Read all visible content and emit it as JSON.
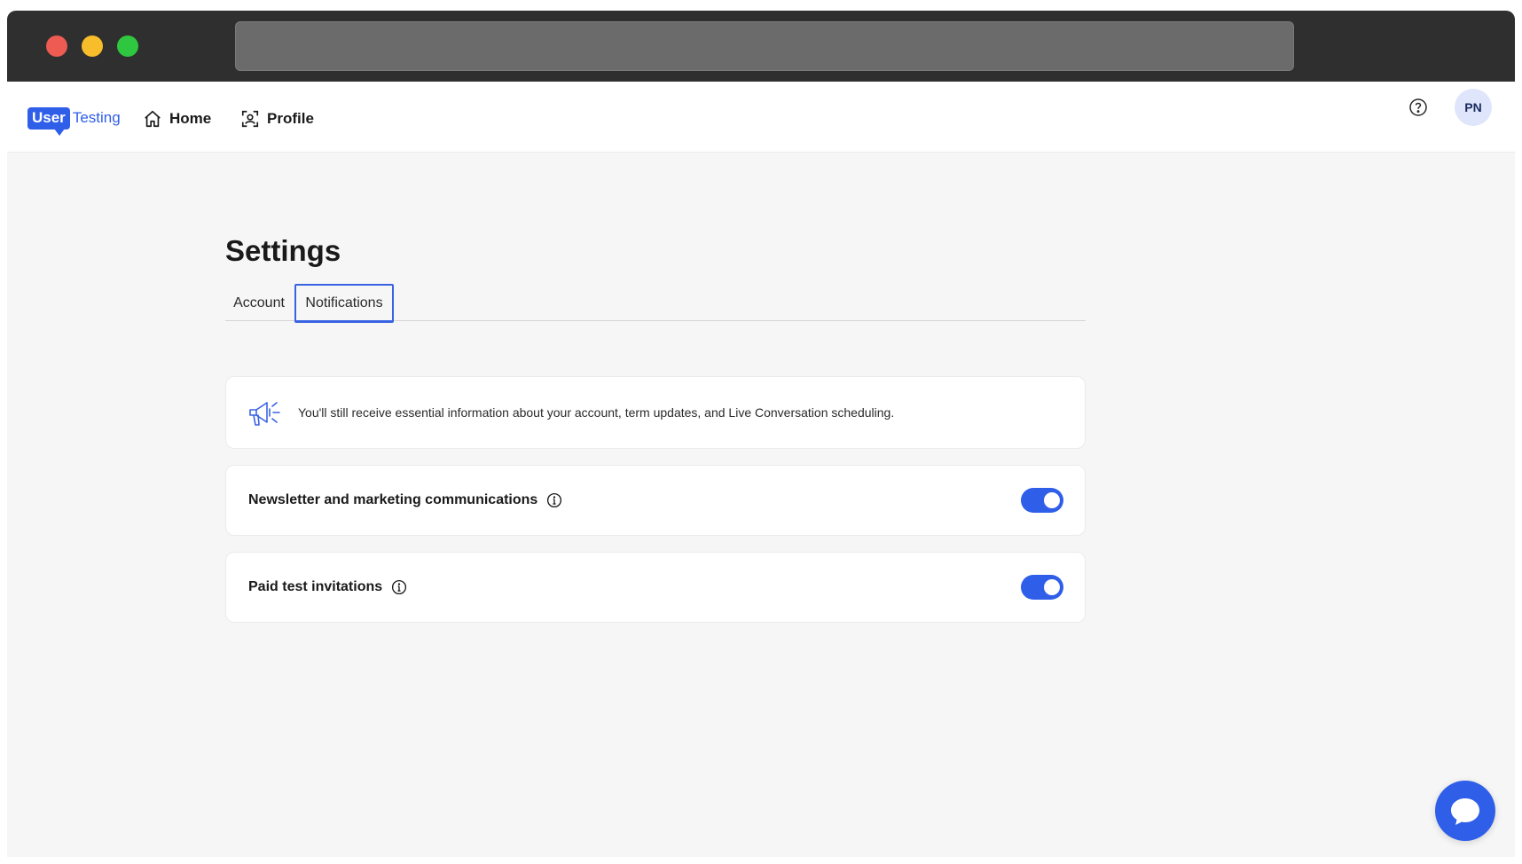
{
  "header": {
    "logo_user": "User",
    "logo_testing": "Testing",
    "nav": [
      {
        "label": "Home",
        "icon": "home-icon"
      },
      {
        "label": "Profile",
        "icon": "profile-icon"
      }
    ],
    "help_icon": "help-icon",
    "avatar_initials": "PN"
  },
  "main": {
    "title": "Settings",
    "tabs": [
      {
        "label": "Account",
        "active": false
      },
      {
        "label": "Notifications",
        "active": true
      }
    ],
    "info_text": "You'll still receive essential information about your account, term updates, and Live Conversation scheduling.",
    "settings": [
      {
        "label": "Newsletter and marketing communications",
        "enabled": true
      },
      {
        "label": "Paid test invitations",
        "enabled": true
      }
    ]
  },
  "chat_icon": "chat-bubble-icon",
  "colors": {
    "accent": "#2f5ee9",
    "avatar_bg": "#dfe6fb",
    "page_bg": "#f6f6f6"
  }
}
